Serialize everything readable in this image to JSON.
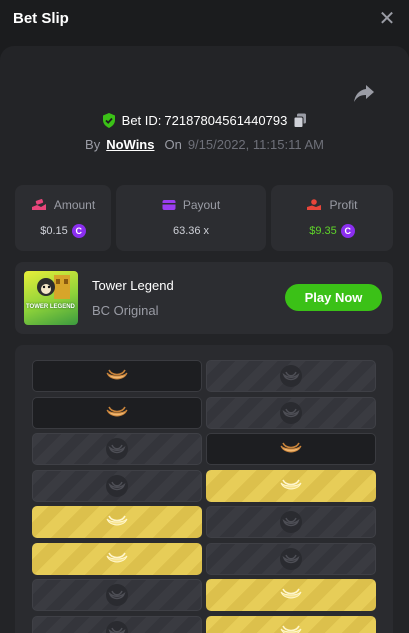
{
  "header": {
    "title": "Bet Slip",
    "close_icon": "close-icon"
  },
  "bet": {
    "id_label": "Bet ID:",
    "id_value": "72187804561440793",
    "by_label": "By",
    "user": "NoWins",
    "on_label": "On",
    "date": "9/15/2022, 11:15:11 AM"
  },
  "stats": [
    {
      "label": "Amount",
      "value": "$0.15",
      "coin": true,
      "icon": "money-hand-icon",
      "icon_color": "#e8457a"
    },
    {
      "label": "Payout",
      "value": "63.36 x",
      "coin": false,
      "icon": "wallet-icon",
      "icon_color": "#9b3df0"
    },
    {
      "label": "Profit",
      "value": "$9.35",
      "coin": true,
      "icon": "profit-hand-icon",
      "icon_color": "#e8453a",
      "value_color": "#5fd42a"
    }
  ],
  "coin_symbol": "C",
  "game": {
    "name": "Tower Legend",
    "subtitle": "BC Original",
    "thumb_text": "TOWER LEGEND",
    "play_label": "Play Now"
  },
  "board": {
    "rows": [
      [
        "empty-banana",
        "dark-coin"
      ],
      [
        "empty-banana",
        "dark-coin"
      ],
      [
        "dark-coin",
        "empty-banana"
      ],
      [
        "dark-coin",
        "gold-banana"
      ],
      [
        "gold-banana",
        "dark-coin"
      ],
      [
        "gold-banana",
        "dark-coin"
      ],
      [
        "dark-coin",
        "gold-banana"
      ],
      [
        "dark-coin",
        "gold-banana"
      ]
    ]
  },
  "colors": {
    "accent_green": "#3bc117",
    "coin_purple": "#8b2ef0",
    "tile_gold": "#e7cd58"
  }
}
